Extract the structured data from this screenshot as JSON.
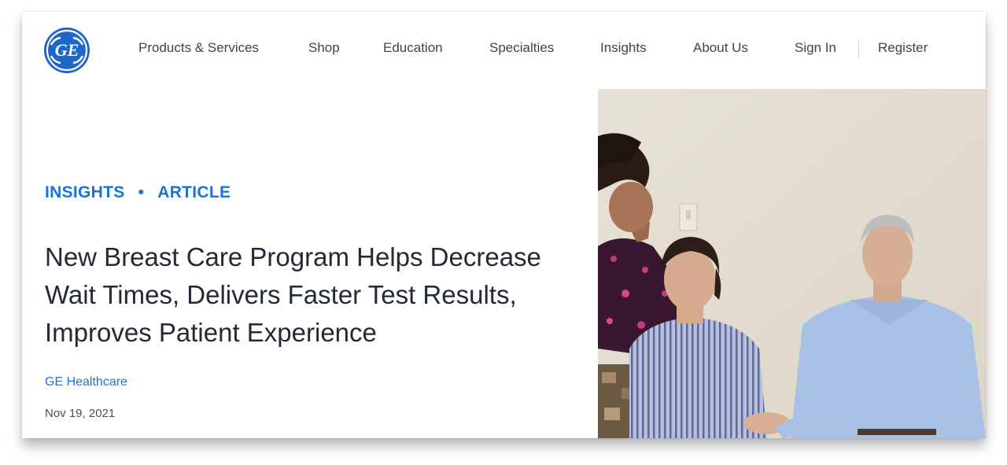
{
  "header": {
    "logo_text": "GE",
    "nav": [
      {
        "label": "Products & Services"
      },
      {
        "label": "Shop"
      },
      {
        "label": "Education"
      },
      {
        "label": "Specialties"
      },
      {
        "label": "Insights"
      },
      {
        "label": "About Us"
      },
      {
        "label": "Sign In"
      },
      {
        "label": "Register"
      }
    ]
  },
  "article": {
    "category": "INSIGHTS",
    "separator": "•",
    "type": "ARTICLE",
    "title": "New Breast Care Program Helps Decrease Wait Times, Delivers Faster Test Results, Improves Patient Experience",
    "author": "GE Healthcare",
    "date": "Nov 19, 2021"
  },
  "colors": {
    "accent": "#1a73d9",
    "logo_blue": "#1f66c9",
    "headline": "#222a36"
  },
  "hero_image": {
    "icon": "photo-three-people"
  }
}
